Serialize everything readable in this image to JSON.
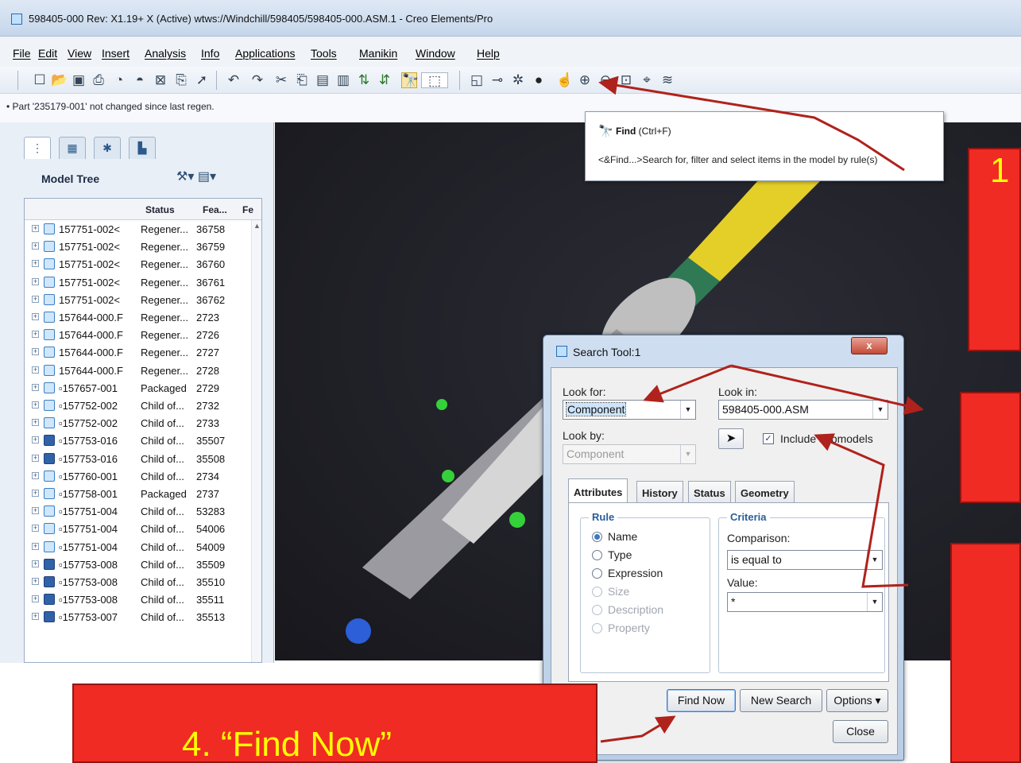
{
  "window": {
    "title": "598405-000 Rev: X1.19+ X  (Active) wtws://Windchill/598405/598405-000.ASM.1 - Creo Elements/Pro"
  },
  "menu": [
    "File",
    "Edit",
    "View",
    "Insert",
    "Analysis",
    "Info",
    "Applications",
    "Tools",
    "Manikin",
    "Window",
    "Help"
  ],
  "toolbar_icons": [
    "new-icon",
    "open-icon",
    "save-icon",
    "print-icon",
    "preview-icon",
    "save-copy-icon",
    "close-window-icon",
    "rename-icon",
    "backup-icon",
    "undo-icon",
    "redo-icon",
    "cut-icon",
    "copy-icon",
    "paste-icon",
    "paste-special-icon",
    "regenerate-icon",
    "regen-manager-icon",
    "find-icon",
    "select-box-icon",
    "saved-views-icon",
    "datum-icon",
    "spin-center-icon",
    "appearance-icon",
    "orient-icon",
    "zoom-in-icon",
    "zoom-out-icon",
    "refit-icon",
    "annotation-icon",
    "layers-icon"
  ],
  "status_message": "• Part '235179-001' not changed since last regen.",
  "panel": {
    "tabs": [
      "model-tree-tab",
      "folder-browser-tab",
      "favorites-tab",
      "connections-tab"
    ],
    "title": "Model Tree",
    "columns": [
      "Status",
      "Fea...",
      "Fe"
    ],
    "rows": [
      {
        "name": "157751-002<",
        "status": "Regener...",
        "feat": "36758",
        "asm": false
      },
      {
        "name": "157751-002<",
        "status": "Regener...",
        "feat": "36759",
        "asm": false
      },
      {
        "name": "157751-002<",
        "status": "Regener...",
        "feat": "36760",
        "asm": false
      },
      {
        "name": "157751-002<",
        "status": "Regener...",
        "feat": "36761",
        "asm": false
      },
      {
        "name": "157751-002<",
        "status": "Regener...",
        "feat": "36762",
        "asm": false
      },
      {
        "name": "157644-000.F",
        "status": "Regener...",
        "feat": "2723",
        "asm": false
      },
      {
        "name": "157644-000.F",
        "status": "Regener...",
        "feat": "2726",
        "asm": false
      },
      {
        "name": "157644-000.F",
        "status": "Regener...",
        "feat": "2727",
        "asm": false
      },
      {
        "name": "157644-000.F",
        "status": "Regener...",
        "feat": "2728",
        "asm": false
      },
      {
        "name": "▫157657-001",
        "status": "Packaged",
        "feat": "2729",
        "asm": false
      },
      {
        "name": "▫157752-002",
        "status": "Child of...",
        "feat": "2732",
        "asm": false
      },
      {
        "name": "▫157752-002",
        "status": "Child of...",
        "feat": "2733",
        "asm": false
      },
      {
        "name": "▫157753-016",
        "status": "Child of...",
        "feat": "35507",
        "asm": true
      },
      {
        "name": "▫157753-016",
        "status": "Child of...",
        "feat": "35508",
        "asm": true
      },
      {
        "name": "▫157760-001",
        "status": "Child of...",
        "feat": "2734",
        "asm": false
      },
      {
        "name": "▫157758-001",
        "status": "Packaged",
        "feat": "2737",
        "asm": false
      },
      {
        "name": "▫157751-004",
        "status": "Child of...",
        "feat": "53283",
        "asm": false
      },
      {
        "name": "▫157751-004",
        "status": "Child of...",
        "feat": "54006",
        "asm": false
      },
      {
        "name": "▫157751-004",
        "status": "Child of...",
        "feat": "54009",
        "asm": false
      },
      {
        "name": "▫157753-008",
        "status": "Child of...",
        "feat": "35509",
        "asm": true
      },
      {
        "name": "▫157753-008",
        "status": "Child of...",
        "feat": "35510",
        "asm": true
      },
      {
        "name": "▫157753-008",
        "status": "Child of...",
        "feat": "35511",
        "asm": true
      },
      {
        "name": "▫157753-007",
        "status": "Child of...",
        "feat": "35513",
        "asm": true
      }
    ]
  },
  "tooltip": {
    "title": "Find",
    "shortcut": "(Ctrl+F)",
    "description": "<&Find...>Search for, filter and select items in the model by rule(s)"
  },
  "dialog": {
    "title": "Search Tool:1",
    "close_label": "x",
    "look_for_label": "Look for:",
    "look_for_value": "Component",
    "look_in_label": "Look in:",
    "look_in_value": "598405-000.ASM",
    "look_by_label": "Look by:",
    "look_by_value": "Component",
    "include_submodels_label": "Include submodels",
    "include_submodels_checked": true,
    "tabs": [
      "Attributes",
      "History",
      "Status",
      "Geometry"
    ],
    "active_tab": "Attributes",
    "rule_label": "Rule",
    "rules": [
      {
        "label": "Name",
        "selected": true,
        "enabled": true
      },
      {
        "label": "Type",
        "selected": false,
        "enabled": true
      },
      {
        "label": "Expression",
        "selected": false,
        "enabled": true
      },
      {
        "label": "Size",
        "selected": false,
        "enabled": false
      },
      {
        "label": "Description",
        "selected": false,
        "enabled": false
      },
      {
        "label": "Property",
        "selected": false,
        "enabled": false
      }
    ],
    "criteria_label": "Criteria",
    "comparison_label": "Comparison:",
    "comparison_value": "is equal to",
    "value_label": "Value:",
    "value_value": "*",
    "buttons": {
      "find_now": "Find Now",
      "new_search": "New Search",
      "options": "Options ▾",
      "close": "Close"
    }
  },
  "callouts": {
    "one": "1",
    "four": "4. “Find Now”"
  },
  "colors": {
    "callout_fill": "#ef2b24",
    "callout_text": "#ffff00",
    "arrow": "#b0221c"
  }
}
